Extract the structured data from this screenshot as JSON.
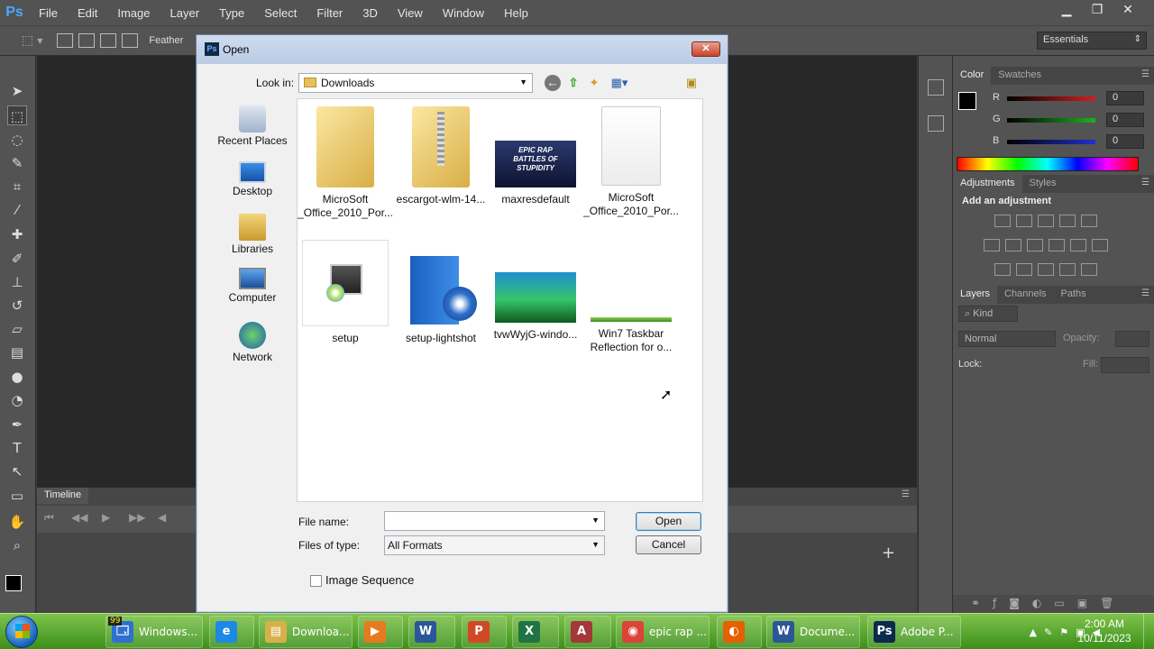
{
  "app": {
    "logo": "Ps",
    "menus": [
      "File",
      "Edit",
      "Image",
      "Layer",
      "Type",
      "Select",
      "Filter",
      "3D",
      "View",
      "Window",
      "Help"
    ],
    "options_bar": {
      "feather_label": "Feather"
    },
    "workspace": "Essentials"
  },
  "panels": {
    "color": {
      "tabs": [
        "Color",
        "Swatches"
      ],
      "channels": [
        {
          "label": "R",
          "value": "0",
          "color": "#d02020"
        },
        {
          "label": "G",
          "value": "0",
          "color": "#20b020"
        },
        {
          "label": "B",
          "value": "0",
          "color": "#2030d0"
        }
      ]
    },
    "adjustments": {
      "tabs": [
        "Adjustments",
        "Styles"
      ],
      "heading": "Add an adjustment"
    },
    "layers": {
      "tabs": [
        "Layers",
        "Channels",
        "Paths"
      ],
      "filter_kind": "Kind",
      "blend_mode": "Normal",
      "opacity_label": "Opacity:",
      "lock_label": "Lock:",
      "fill_label": "Fill:"
    },
    "timeline": {
      "tab": "Timeline"
    }
  },
  "dialog": {
    "icon": "Ps",
    "title": "Open",
    "close": "✕",
    "look_in_label": "Look in:",
    "look_in_value": "Downloads",
    "places": [
      "Recent Places",
      "Desktop",
      "Libraries",
      "Computer",
      "Network"
    ],
    "files": [
      {
        "name_line1": "MicroSoft",
        "name_line2": "_Office_2010_Por...",
        "kind": "folder"
      },
      {
        "name_line1": "escargot-wlm-14...",
        "name_line2": "",
        "kind": "zip"
      },
      {
        "name_line1": "maxresdefault",
        "name_line2": "",
        "kind": "image-epic"
      },
      {
        "name_line1": "MicroSoft",
        "name_line2": "_Office_2010_Por...",
        "kind": "blank"
      },
      {
        "name_line1": "setup",
        "name_line2": "",
        "kind": "setup"
      },
      {
        "name_line1": "setup-lightshot",
        "name_line2": "",
        "kind": "box"
      },
      {
        "name_line1": "tvwWyjG-windo...",
        "name_line2": "",
        "kind": "image-green"
      },
      {
        "name_line1": "Win7 Taskbar",
        "name_line2": "Reflection for o...",
        "kind": "strip"
      }
    ],
    "thumb_text": "EPIC RAP BATTLES OF STUPIDITY",
    "file_name_label": "File name:",
    "file_name_value": "",
    "files_of_type_label": "Files of type:",
    "files_of_type_value": "All Formats",
    "open_button": "Open",
    "cancel_button": "Cancel",
    "image_sequence_label": "Image Sequence"
  },
  "taskbar": {
    "items": [
      {
        "label": "Windows...",
        "icon": "windows-explorer-icon",
        "color": "#2f6fd0",
        "badge": "99"
      },
      {
        "label": "",
        "icon": "internet-explorer-icon",
        "color": "#1e88e5"
      },
      {
        "label": "Downloa...",
        "icon": "folder-icon",
        "color": "#d8b04a"
      },
      {
        "label": "",
        "icon": "media-player-icon",
        "color": "#e57a1e"
      },
      {
        "label": "",
        "icon": "word-icon",
        "color": "#2b579a"
      },
      {
        "label": "",
        "icon": "powerpoint-icon",
        "color": "#d24726"
      },
      {
        "label": "",
        "icon": "excel-icon",
        "color": "#217346"
      },
      {
        "label": "",
        "icon": "access-icon",
        "color": "#a4373a"
      },
      {
        "label": "epic rap ...",
        "icon": "chrome-icon",
        "color": "#db4437"
      },
      {
        "label": "",
        "icon": "firefox-icon",
        "color": "#e66000"
      },
      {
        "label": "Docume...",
        "icon": "word-icon",
        "color": "#2b579a"
      },
      {
        "label": "Adobe P...",
        "icon": "photoshop-icon",
        "color": "#0a2a4f"
      }
    ],
    "time": "2:00 AM",
    "date": "10/11/2023"
  }
}
